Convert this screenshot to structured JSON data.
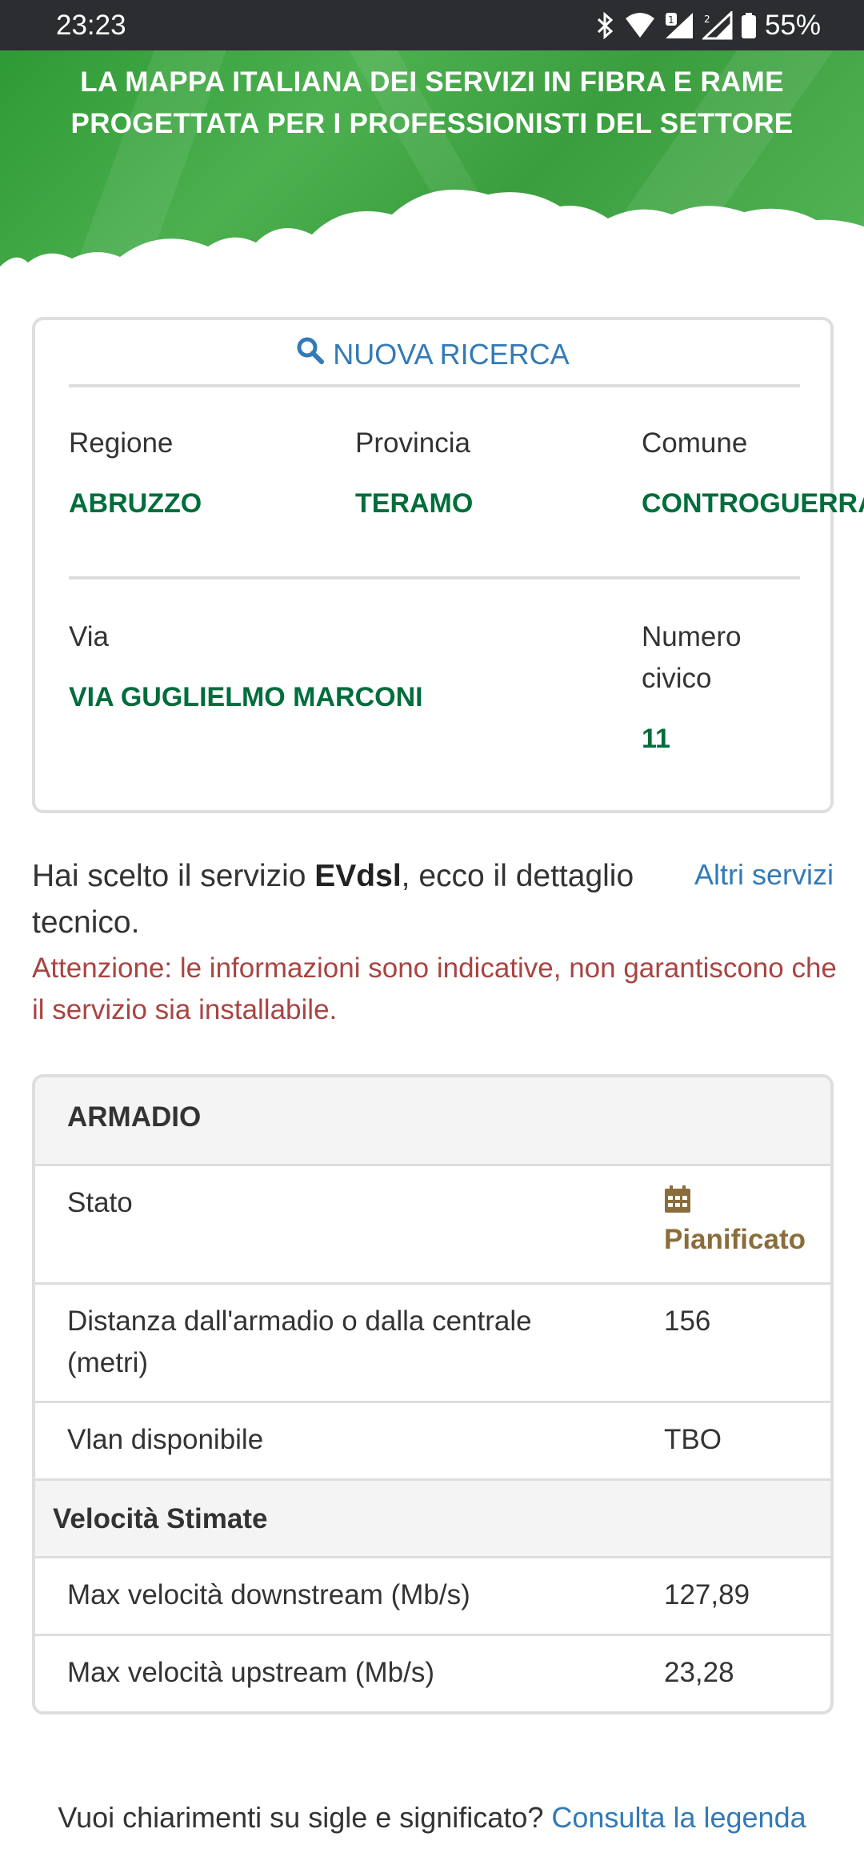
{
  "status_bar": {
    "time": "23:23",
    "battery": "55%",
    "icons": [
      "bluetooth-icon",
      "wifi-icon",
      "signal-sim1-icon",
      "signal-sim2-icon",
      "battery-icon"
    ]
  },
  "hero": {
    "title_line1": "LA MAPPA ITALIANA DEI SERVIZI IN FIBRA E RAME",
    "title_line2": "PROGETTATA PER I PROFESSIONISTI DEL SETTORE"
  },
  "search": {
    "new_search_label": "NUOVA RICERCA",
    "regione_label": "Regione",
    "regione_value": "ABRUZZO",
    "provincia_label": "Provincia",
    "provincia_value": "TERAMO",
    "comune_label": "Comune",
    "comune_value": "CONTROGUERRA",
    "via_label": "Via",
    "via_value": "VIA GUGLIELMO MARCONI",
    "civico_label_line1": "Numero",
    "civico_label_line2": "civico",
    "civico_value": "11"
  },
  "service": {
    "intro_before": "Hai scelto il servizio ",
    "service_name": "EVdsl",
    "intro_after": ", ecco il dettaglio tecnico.",
    "other_services_link": "Altri servizi",
    "warning": "Attenzione: le informazioni sono indicative, non garantiscono che il servizio sia installabile."
  },
  "table": {
    "section_title": "ARMADIO",
    "rows": [
      {
        "label": "Stato",
        "value": "Pianificato"
      },
      {
        "label": "Distanza dall'armadio o dalla centrale (metri)",
        "value": "156"
      },
      {
        "label": "Vlan disponibile",
        "value": "TBO"
      }
    ],
    "speed_heading": "Velocità Stimate",
    "speed_rows": [
      {
        "label": "Max velocità downstream (Mb/s)",
        "value": "127,89"
      },
      {
        "label": "Max velocità upstream (Mb/s)",
        "value": "23,28"
      }
    ]
  },
  "footer": {
    "question": "Vuoi chiarimenti su sigle e significato? ",
    "legend_link": "Consulta la legenda"
  },
  "colors": {
    "green_value": "#006d3c",
    "link_blue": "#337ab7",
    "warning_red": "#a94442",
    "planned_brown": "#8a6d3b"
  }
}
